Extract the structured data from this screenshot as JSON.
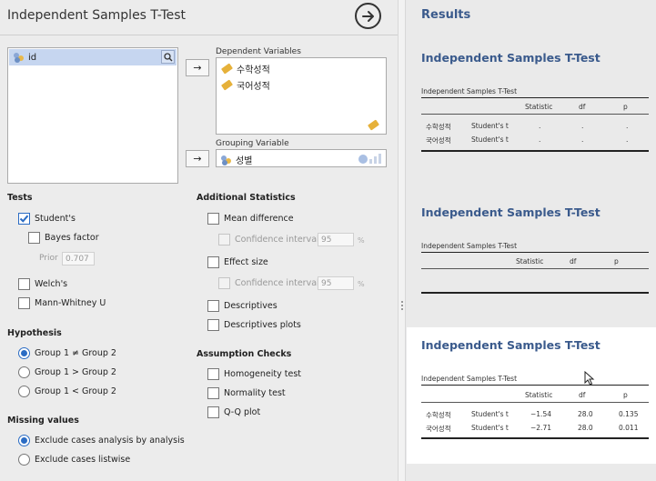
{
  "analysis": {
    "title": "Independent Samples T-Test",
    "variables_list": [
      {
        "name": "id"
      }
    ],
    "dependent_label": "Dependent Variables",
    "dependent_vars": [
      "수학성적",
      "국어성적"
    ],
    "grouping_label": "Grouping Variable",
    "grouping_var": "성별",
    "move_arrow": "→"
  },
  "tests": {
    "header": "Tests",
    "students": {
      "label": "Student's",
      "checked": true
    },
    "bayes": {
      "label": "Bayes factor",
      "checked": false
    },
    "prior_label": "Prior",
    "prior_value": "0.707",
    "welch": {
      "label": "Welch's",
      "checked": false
    },
    "mann": {
      "label": "Mann-Whitney U",
      "checked": false
    }
  },
  "additional": {
    "header": "Additional Statistics",
    "mean_diff": "Mean difference",
    "ci1": "Confidence interval",
    "ci1_value": "95",
    "effect": "Effect size",
    "ci2": "Confidence interval",
    "ci2_value": "95",
    "pct": "%",
    "descriptives": "Descriptives",
    "desc_plots": "Descriptives plots"
  },
  "hypothesis": {
    "header": "Hypothesis",
    "options": [
      "Group 1 ≠ Group 2",
      "Group 1 > Group 2",
      "Group 1 < Group 2"
    ],
    "selected": 0
  },
  "assumption": {
    "header": "Assumption Checks",
    "homogeneity": "Homogeneity test",
    "normality": "Normality test",
    "qq": "Q-Q plot"
  },
  "missing": {
    "header": "Missing values",
    "options": [
      "Exclude cases analysis by analysis",
      "Exclude cases listwise"
    ],
    "selected": 0
  },
  "results": {
    "header": "Results",
    "tables": [
      {
        "title": "Independent Samples T-Test",
        "caption": "Independent Samples T-Test",
        "columns": [
          "",
          "",
          "Statistic",
          "df",
          "p"
        ],
        "rows": [
          [
            "수학성적",
            "Student's t",
            ".",
            ".",
            "."
          ],
          [
            "국어성적",
            "Student's t",
            ".",
            ".",
            "."
          ]
        ]
      },
      {
        "title": "Independent Samples T-Test",
        "caption": "Independent Samples T-Test",
        "columns": [
          "",
          "",
          "Statistic",
          "df",
          "p"
        ],
        "rows": []
      },
      {
        "title": "Independent Samples T-Test",
        "caption": "Independent Samples T-Test",
        "columns": [
          "",
          "",
          "Statistic",
          "df",
          "p"
        ],
        "rows": [
          [
            "수학성적",
            "Student's t",
            "−1.54",
            "28.0",
            "0.135"
          ],
          [
            "국어성적",
            "Student's t",
            "−2.71",
            "28.0",
            "0.011"
          ]
        ]
      }
    ]
  }
}
